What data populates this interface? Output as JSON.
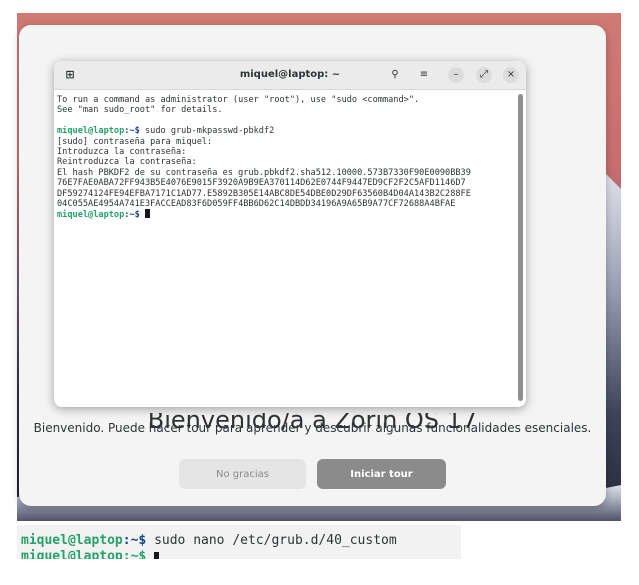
{
  "welcome": {
    "title": "Bienvenido/a a Zorin OS 17",
    "subtitle": "Bienvenido. Puede hacer tour para aprender y descubrir algunas funcionalidades esenciales.",
    "no_thanks": "No gracias",
    "start_tour": "Iniciar tour"
  },
  "terminal": {
    "title": "miquel@laptop: ~",
    "icons": {
      "new_tab": "new-tab-icon",
      "search": "search-icon",
      "menu": "hamburger-menu-icon",
      "minimize": "minimize-icon",
      "maximize": "maximize-icon",
      "close": "close-icon"
    },
    "prompt_user": "miquel@laptop",
    "prompt_path": ":~$ ",
    "lines": {
      "l1": "To run a command as administrator (user \"root\"), use \"sudo <command>\".",
      "l2": "See \"man sudo_root\" for details.",
      "cmd": "sudo grub-mkpasswd-pbkdf2",
      "l4": "[sudo] contraseña para miquel:",
      "l5": "Introduzca la contraseña:",
      "l6": "Reintroduzca la contraseña:",
      "l7": "El hash PBKDF2 de su contraseña es grub.pbkdf2.sha512.10000.573B7330F90E0090BB39",
      "l8": "76E7FAE0ABA72FF943B5E4076E9015F3920A9B9EA370114D62E0744F9447ED9CF2F2C5AFD1146D7",
      "l9": "DF59274124FE94EFBA7171C1AD77.E5892B305E14ABC8DE54DBE0D29DF63560B4D04A143B2C288FE",
      "l10": "04C055AE4954A741E3FACCEAD83F6D059FF4BB6D62C14DBDD34196A9A65B9A77CF72688A4BFAE"
    }
  },
  "bottom_terminal": {
    "prompt_user": "miquel@laptop",
    "prompt_path": ":~$ ",
    "cmd": "sudo nano /etc/grub.d/40_custom",
    "line2": "miquel@laptop:~$ "
  },
  "colors": {
    "prompt_user": "#26a269",
    "prompt_path": "#12488b",
    "tour_button": "#8b8b8b"
  }
}
